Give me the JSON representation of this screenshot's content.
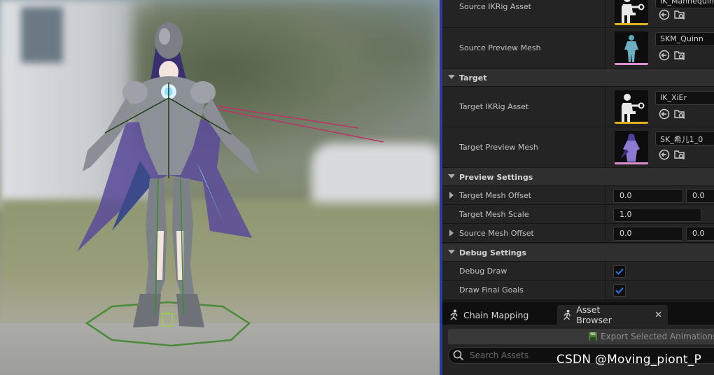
{
  "panel": {
    "source": {
      "ikrig_label": "Source IKRig Asset",
      "ikrig_value": "IK_Mannequin",
      "preview_mesh_label": "Source Preview Mesh",
      "preview_mesh_value": "SKM_Quinn"
    },
    "target_section": {
      "label": "Target"
    },
    "target": {
      "ikrig_label": "Target IKRig Asset",
      "ikrig_value": "IK_XiEr",
      "preview_mesh_label": "Target Preview Mesh",
      "preview_mesh_value": "SK_希儿1_0"
    },
    "preview_section": {
      "label": "Preview Settings"
    },
    "preview": {
      "target_offset_label": "Target Mesh Offset",
      "target_offset_x": "0.0",
      "target_offset_y": "0.0",
      "target_scale_label": "Target Mesh Scale",
      "target_scale_value": "1.0",
      "source_offset_label": "Source Mesh Offset",
      "source_offset_x": "0.0",
      "source_offset_y": "0.0"
    },
    "debug_section": {
      "label": "Debug Settings"
    },
    "debug": {
      "debug_draw_label": "Debug Draw",
      "debug_draw_checked": true,
      "draw_final_goals_label": "Draw Final Goals",
      "draw_final_goals_checked": true
    }
  },
  "tabs": [
    {
      "label": "Chain Mapping",
      "icon": "running-figure-icon"
    },
    {
      "label": "Asset Browser",
      "icon": "running-figure-icon",
      "closable": true
    }
  ],
  "asset_browser": {
    "export_label": "Export Selected Animations",
    "search_placeholder": "Search Assets"
  },
  "watermark": "CSDN @Moving_piont_P",
  "colors": {
    "ikrig_bar": "#e0b020",
    "mesh_bar": "#e090d0",
    "checkbox": "#2a6fd6",
    "splitter": "#2d3a9a"
  }
}
